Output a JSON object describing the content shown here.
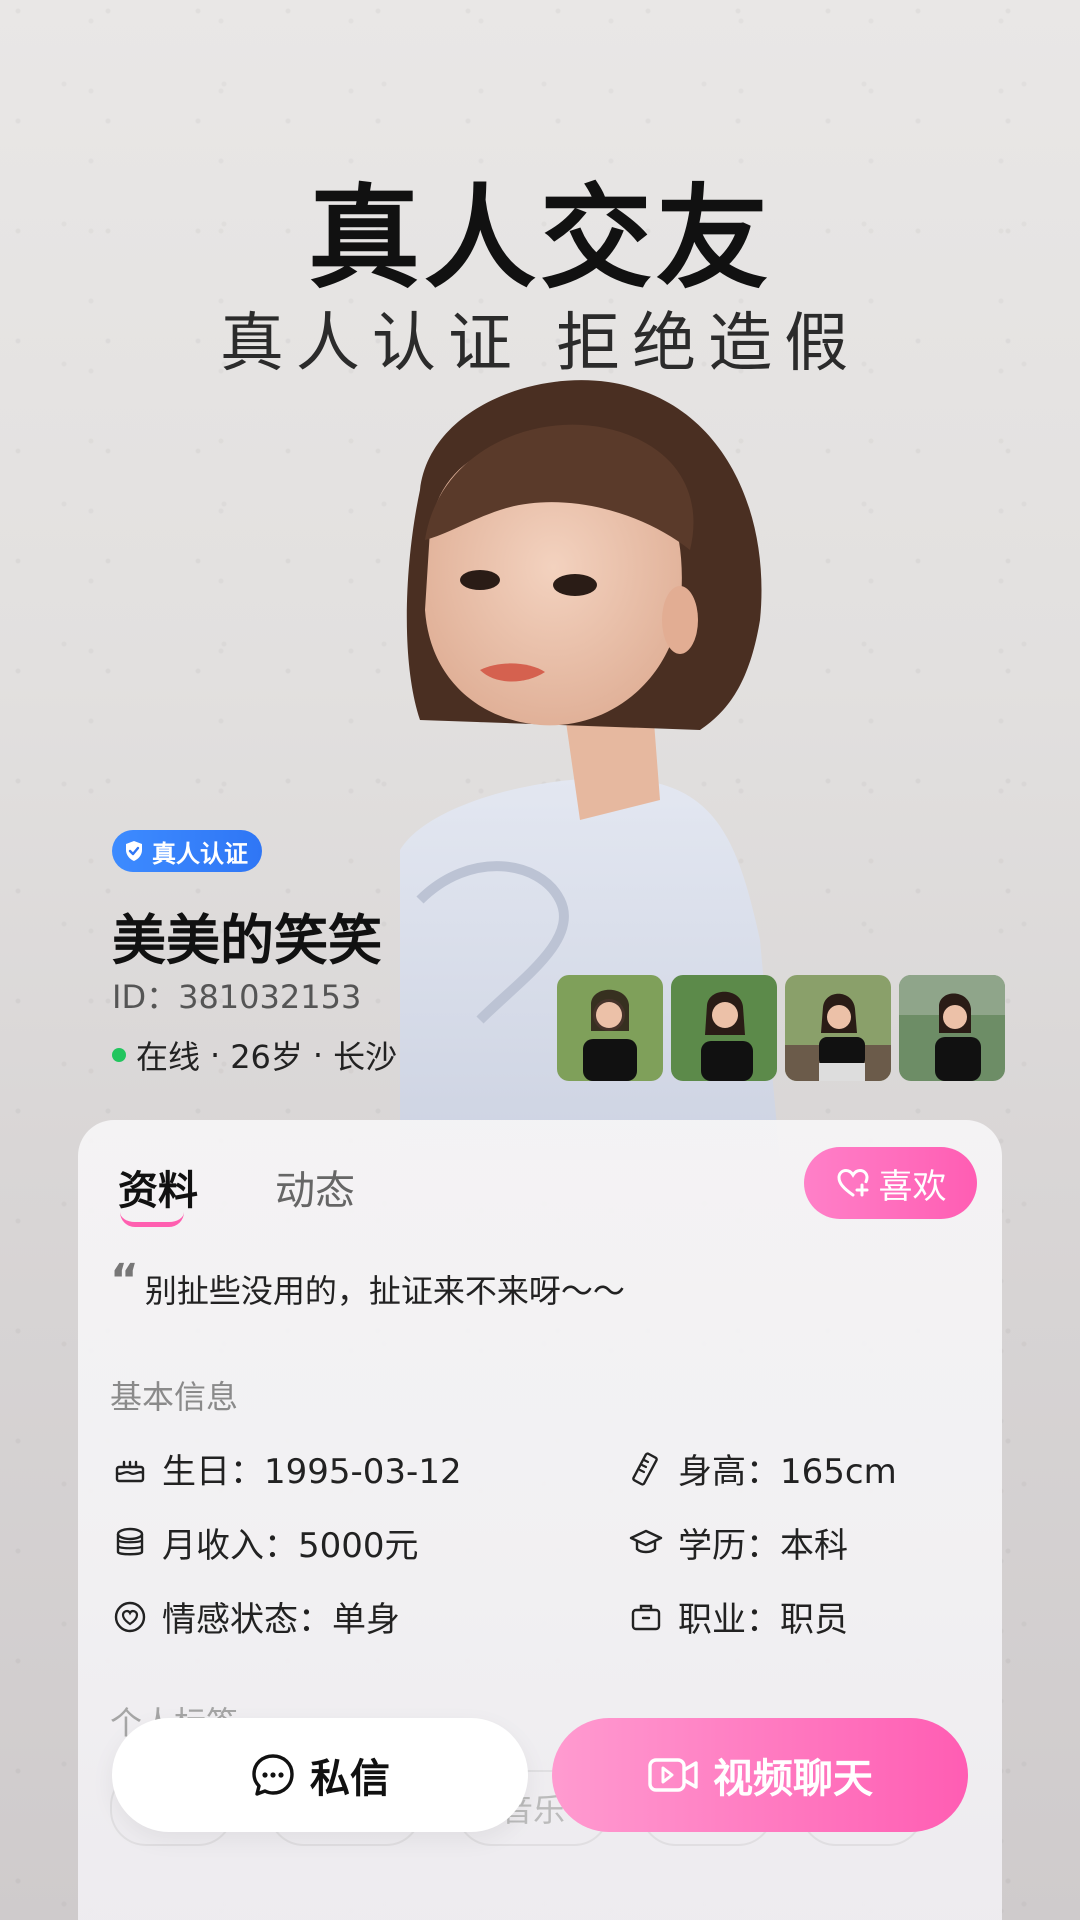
{
  "hero": {
    "title": "真人交友",
    "subtitle": "真人认证 拒绝造假"
  },
  "profile": {
    "verify_badge": "真人认证",
    "name": "美美的笑笑",
    "id_text": "ID：381032153",
    "status": "在线",
    "age": "26岁",
    "city": "长沙",
    "separator": "·"
  },
  "tabs": {
    "profile": "资料",
    "moments": "动态"
  },
  "like_button": "喜欢",
  "quote": "别扯些没用的，扯证来不来呀～～",
  "basic_info": {
    "title": "基本信息",
    "birthday": "生日：1995-03-12",
    "height": "身高：165cm",
    "income": "月收入：5000元",
    "education": "学历：本科",
    "relationship": "情感状态：单身",
    "job": "职业：职员"
  },
  "tags": {
    "title": "个人标签",
    "visible_tag": "音乐"
  },
  "actions": {
    "message": "私信",
    "video": "视频聊天"
  },
  "colors": {
    "accent_pink": "#ff5db3",
    "verify_blue": "#3d8bff",
    "online_green": "#22c55e"
  }
}
